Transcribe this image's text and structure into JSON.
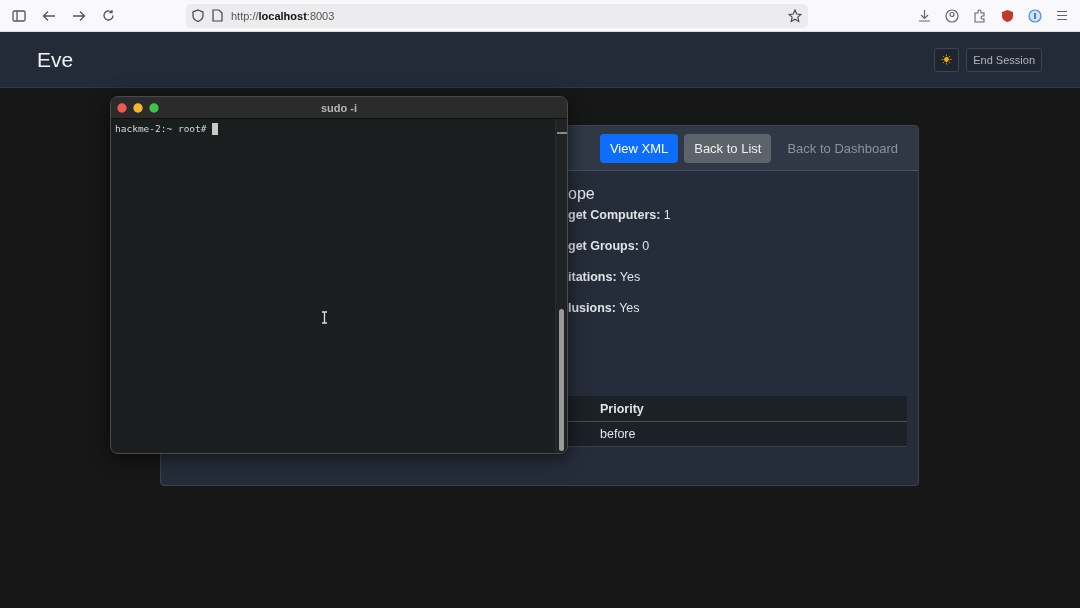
{
  "browser": {
    "url": "http://**localhost**:8003"
  },
  "navbar": {
    "brand": "Eve",
    "end_session": "End Session"
  },
  "terminal": {
    "title": "sudo -i",
    "prompt": "hackme-2:~ root#"
  },
  "card": {
    "buttons": [
      {
        "label": "View XML",
        "kind": "primary"
      },
      {
        "label": "Back to List",
        "kind": "secondary"
      },
      {
        "label": "Back to Dashboard",
        "kind": "link"
      }
    ],
    "heading": "ope",
    "fields": [
      "**get Computers:** 1",
      "**get Groups:** 0",
      "**itations:** Yes",
      "**lusions:** Yes"
    ],
    "table": {
      "columns": [
        "Priority"
      ],
      "rows": [
        [
          "before"
        ]
      ]
    }
  }
}
